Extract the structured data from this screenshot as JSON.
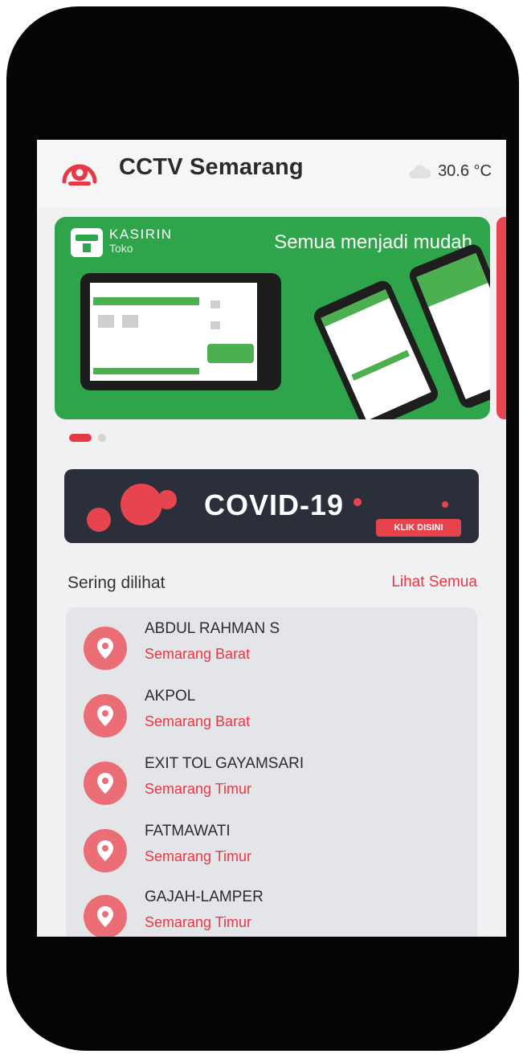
{
  "header": {
    "title": "CCTV Semarang",
    "temperature": "30.6 °C",
    "weather_icon": "cloud-icon",
    "logo_icon": "cctv-logo-icon"
  },
  "banner": {
    "brand": "KASIRIN",
    "brand_sub": "Toko",
    "tagline": "Semua menjadi mudah",
    "color": "#2ea54a"
  },
  "carousel": {
    "active_index": 0,
    "count": 2
  },
  "covid": {
    "title": "COVID-19",
    "button_label": "KLIK DISINI"
  },
  "frequent": {
    "title": "Sering dilihat",
    "see_all": "Lihat Semua",
    "items": [
      {
        "name": "ABDUL RAHMAN S",
        "area": "Semarang Barat"
      },
      {
        "name": "AKPOL",
        "area": "Semarang Barat"
      },
      {
        "name": "EXIT TOL GAYAMSARI",
        "area": "Semarang Timur"
      },
      {
        "name": "FATMAWATI",
        "area": "Semarang Timur"
      },
      {
        "name": "GAJAH-LAMPER",
        "area": "Semarang Timur"
      }
    ]
  },
  "colors": {
    "accent": "#e73845",
    "pin": "#eb6e76",
    "covid_bg": "#2b2f3a"
  }
}
